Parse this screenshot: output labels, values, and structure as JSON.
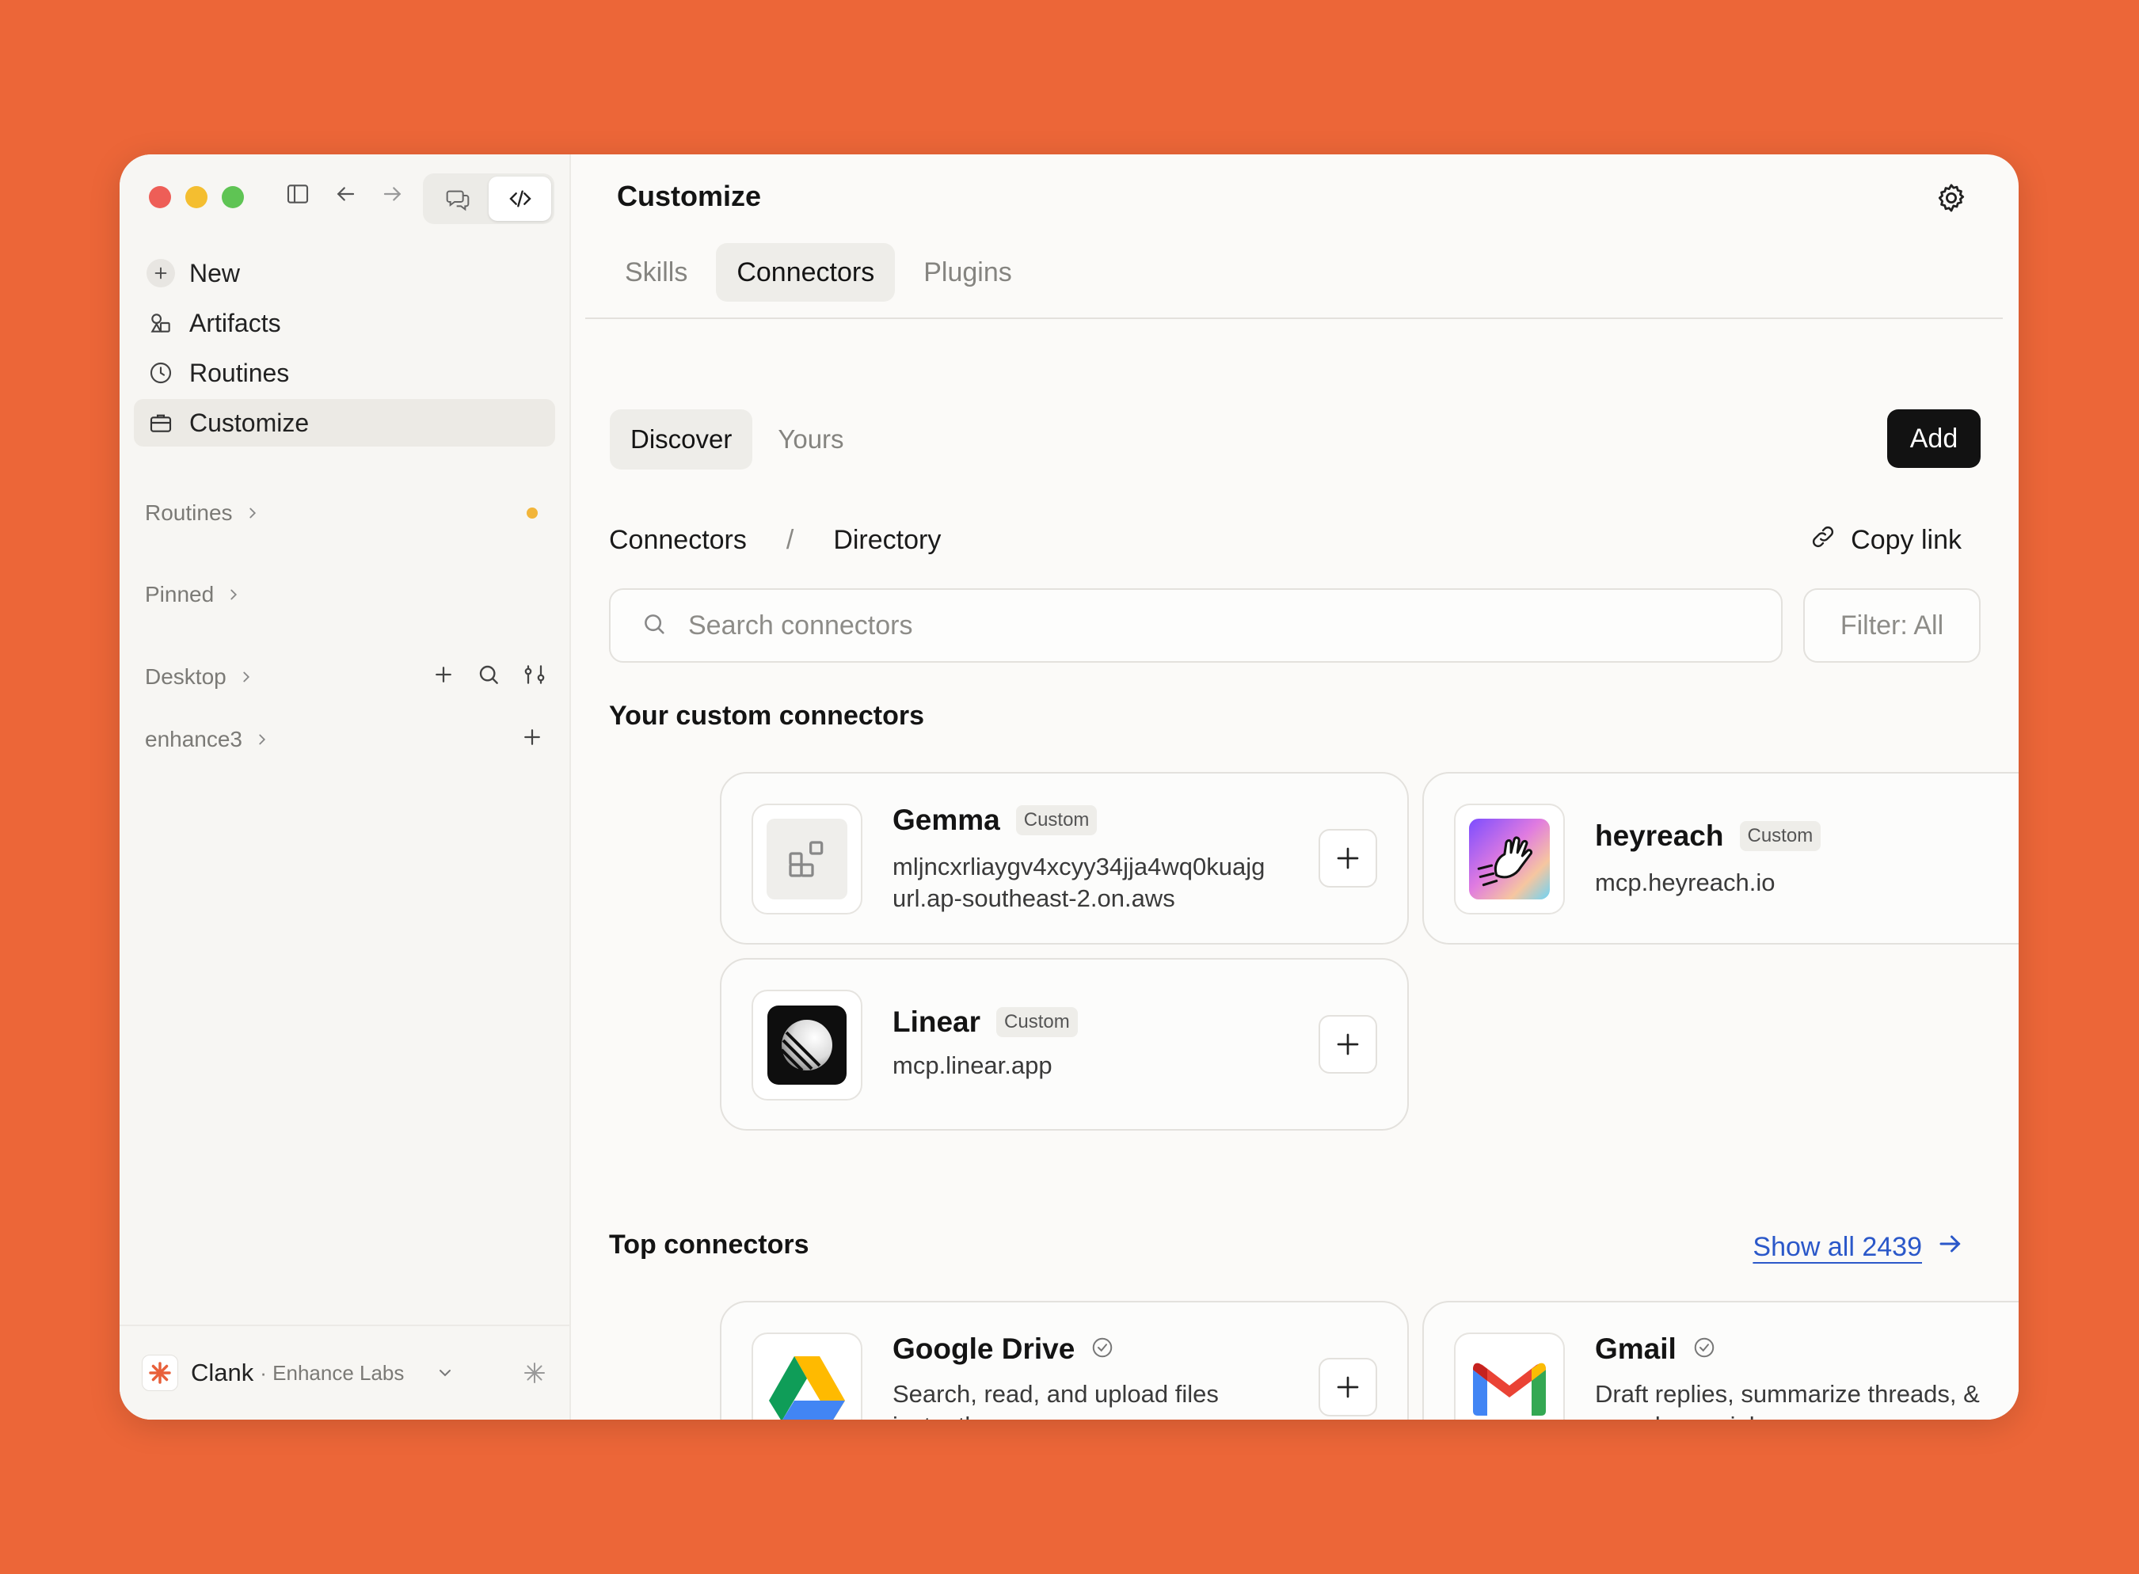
{
  "sidebar": {
    "menu": [
      {
        "label": "New",
        "icon": "plus-icon"
      },
      {
        "label": "Artifacts",
        "icon": "shapes-icon"
      },
      {
        "label": "Routines",
        "icon": "clock-icon"
      },
      {
        "label": "Customize",
        "icon": "briefcase-icon"
      }
    ],
    "sections": {
      "routines": "Routines",
      "pinned": "Pinned",
      "desktop": "Desktop",
      "enhance3": "enhance3"
    },
    "footer": {
      "name": "Clank",
      "org": "· Enhance Labs"
    }
  },
  "main": {
    "title": "Customize",
    "tabs": [
      "Skills",
      "Connectors",
      "Plugins"
    ],
    "active_tab": "Connectors",
    "subtabs": [
      "Discover",
      "Yours"
    ],
    "add_label": "Add",
    "breadcrumb": {
      "root": "Connectors",
      "sep": "/",
      "current": "Directory"
    },
    "copy_link": "Copy link",
    "search_placeholder": "Search connectors",
    "filter_label": "Filter: All",
    "custom_section": "Your custom connectors",
    "custom_connectors": [
      {
        "name": "Gemma",
        "badge": "Custom",
        "desc": "mljncxrliaygv4xcyy34jja4wq0kuajg url.ap-southeast-2.on.aws"
      },
      {
        "name": "heyreach",
        "badge": "Custom",
        "desc": "mcp.heyreach.io"
      },
      {
        "name": "Linear",
        "badge": "Custom",
        "desc": "mcp.linear.app"
      }
    ],
    "top_section": "Top connectors",
    "show_all": "Show all 2439",
    "top_connectors": [
      {
        "name": "Google Drive",
        "desc": "Search, read, and upload files instantly"
      },
      {
        "name": "Gmail",
        "desc": "Draft replies, summarize threads, & search your inbox"
      }
    ]
  },
  "colors": {
    "background": "#EC6638",
    "accent_link": "#2B58C9",
    "add_button": "#121212"
  }
}
